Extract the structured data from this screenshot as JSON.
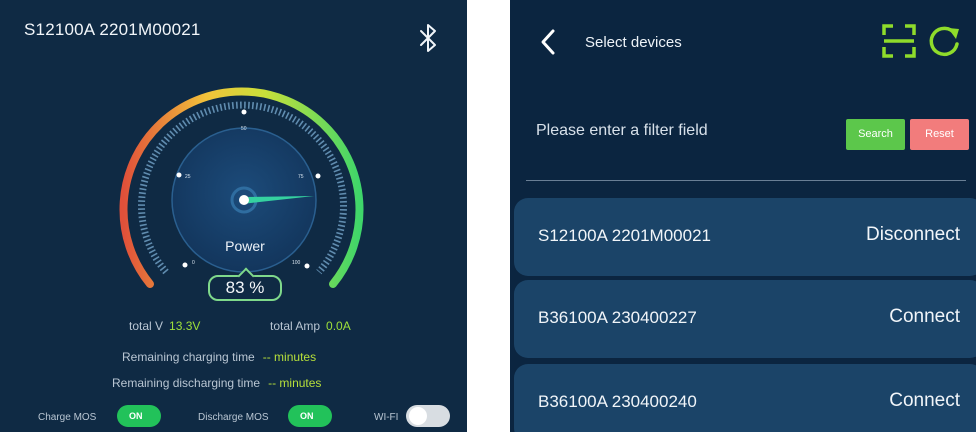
{
  "left": {
    "device_title": "S12100A 2201M00021",
    "bluetooth_icon": "bluetooth-icon",
    "gauge": {
      "percent": 83,
      "percent_text": "83 %",
      "label": "Power",
      "ticks": [
        "0",
        "25",
        "50",
        "75",
        "100"
      ]
    },
    "stats": {
      "total_v_label": "total V",
      "total_v_value": "13.3V",
      "total_amp_label": "total Amp",
      "total_amp_value": "0.0A",
      "charging_label": "Remaining charging time",
      "charging_value": "-- minutes",
      "discharging_label": "Remaining discharging time",
      "discharging_value": "-- minutes"
    },
    "toggles": {
      "charge_mos_label": "Charge MOS",
      "charge_mos_state": "ON",
      "discharge_mos_label": "Discharge MOS",
      "discharge_mos_state": "ON",
      "wifi_label": "WI-FI"
    },
    "colors": {
      "background": "#0f2a44",
      "gauge_start": "#e0503a",
      "gauge_mid": "#f2c23a",
      "gauge_end": "#3fd66a",
      "on": "#22c25a"
    }
  },
  "right": {
    "title": "Select devices",
    "back_icon": "chevron-left-icon",
    "scan_icon": "scan-icon",
    "refresh_icon": "refresh-icon",
    "filter_placeholder": "Please enter a filter field",
    "search_label": "Search",
    "reset_label": "Reset",
    "devices": [
      {
        "name": "S12100A 2201M00021",
        "action": "Disconnect"
      },
      {
        "name": "B36100A 230400227",
        "action": "Connect"
      },
      {
        "name": "B36100A 230400240",
        "action": "Connect"
      }
    ],
    "colors": {
      "accent": "#8fdc2b",
      "search": "#5cc74b",
      "reset": "#f27c7c",
      "row": "#1b4468"
    }
  }
}
